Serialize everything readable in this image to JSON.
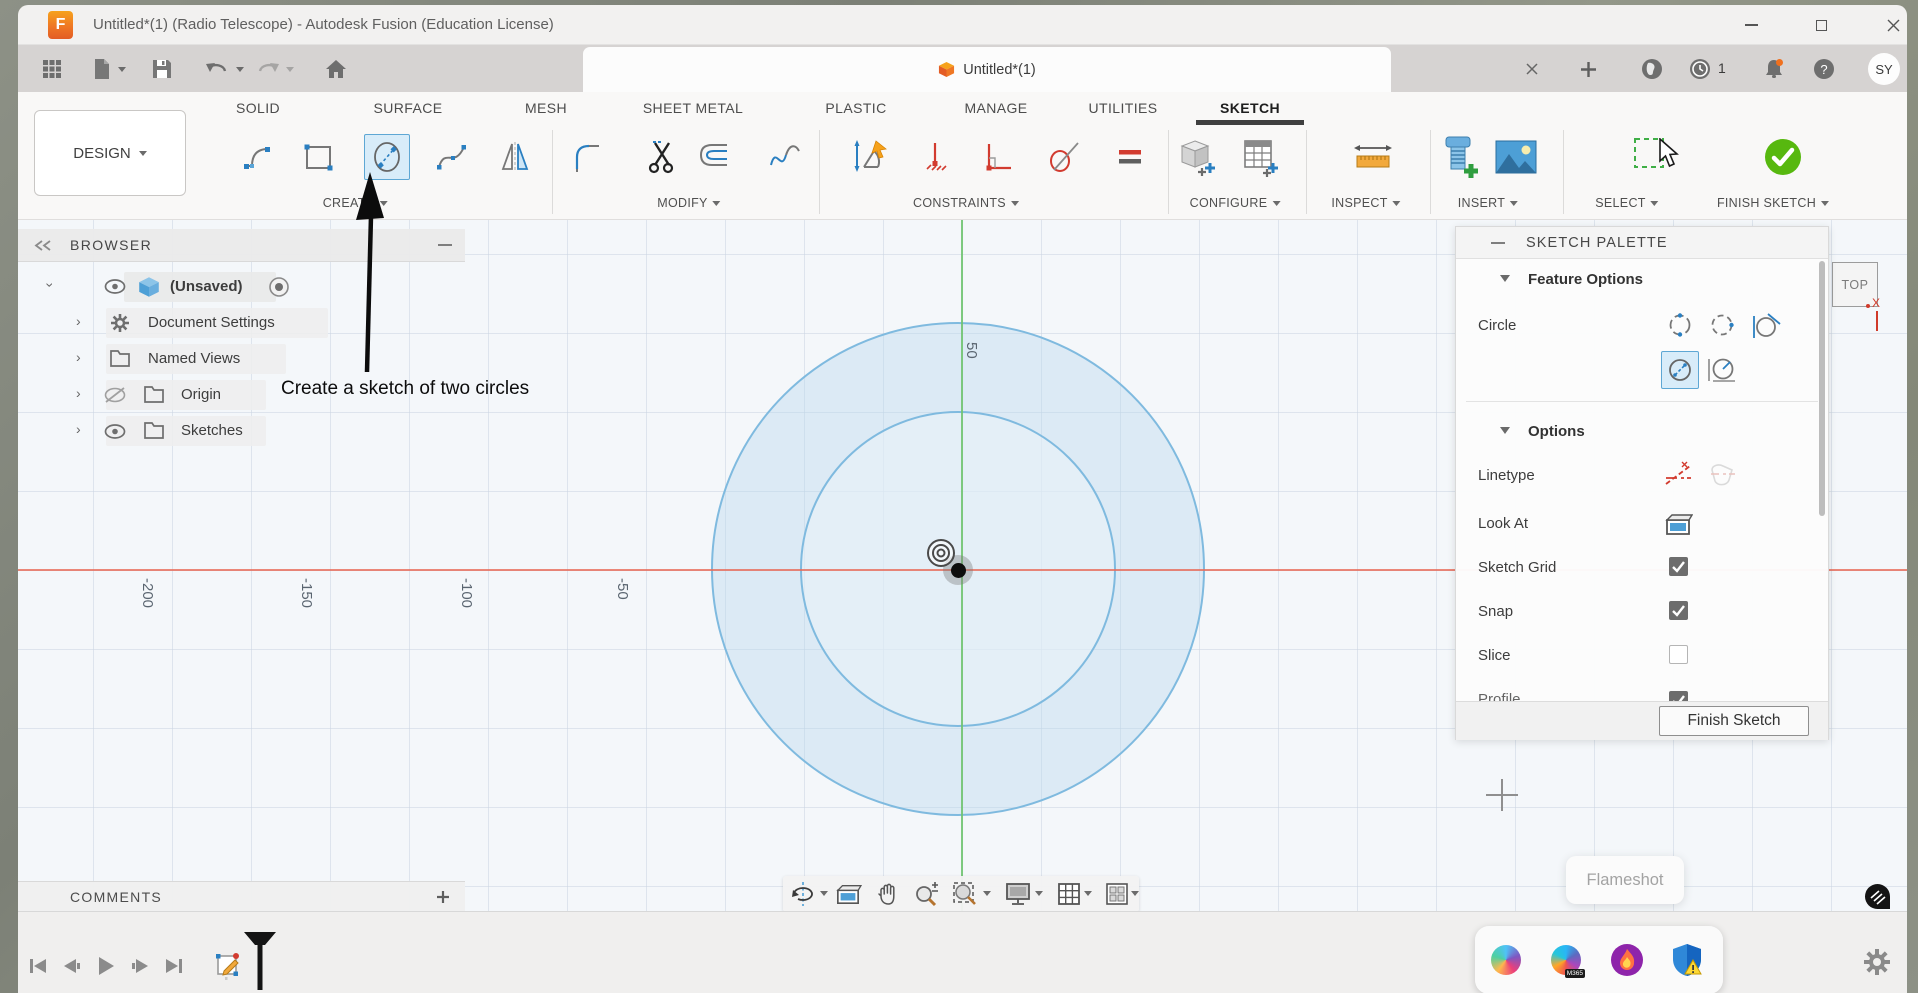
{
  "colors": {
    "axis_red": "#e96a57",
    "axis_green": "#71c471",
    "circle_stroke": "#7fbadf",
    "selection_fill": "#d8ecf9",
    "finish_green": "#57b80f"
  },
  "titlebar": {
    "title": "Untitled*(1) (Radio Telescope) - Autodesk Fusion (Education License)",
    "logo_letter": "F"
  },
  "quickbar": {
    "tab_label": "Untitled*(1)",
    "notification_count": "1",
    "user_initials": "SY",
    "help_glyph": "?"
  },
  "ribbon": {
    "design_label": "DESIGN",
    "active_tab": "SKETCH",
    "tabs": [
      {
        "label": "SOLID"
      },
      {
        "label": "SURFACE"
      },
      {
        "label": "MESH"
      },
      {
        "label": "SHEET METAL"
      },
      {
        "label": "PLASTIC"
      },
      {
        "label": "MANAGE"
      },
      {
        "label": "UTILITIES"
      },
      {
        "label": "SKETCH"
      }
    ],
    "groups": [
      {
        "label": "CREATE"
      },
      {
        "label": "MODIFY"
      },
      {
        "label": "CONSTRAINTS"
      },
      {
        "label": "CONFIGURE"
      },
      {
        "label": "INSPECT"
      },
      {
        "label": "INSERT"
      },
      {
        "label": "SELECT"
      },
      {
        "label": "FINISH SKETCH"
      }
    ]
  },
  "browser": {
    "header": "BROWSER",
    "root_item": "(Unsaved)",
    "items": [
      {
        "label": "Document Settings"
      },
      {
        "label": "Named Views"
      },
      {
        "label": "Origin"
      },
      {
        "label": "Sketches"
      }
    ]
  },
  "annotation": {
    "text": "Create a sketch of two circles"
  },
  "canvas": {
    "x_ticks": [
      {
        "label": "-200"
      },
      {
        "label": "-150"
      },
      {
        "label": "-100"
      },
      {
        "label": "-50"
      }
    ],
    "y_tick": "50"
  },
  "viewcube": {
    "face": "TOP",
    "axis_x": "X"
  },
  "palette": {
    "title": "SKETCH PALETTE",
    "feature_section": "Feature Options",
    "circle_label": "Circle",
    "options_section": "Options",
    "rows": [
      {
        "label": "Linetype"
      },
      {
        "label": "Look At"
      },
      {
        "label": "Sketch Grid",
        "checked": true
      },
      {
        "label": "Snap",
        "checked": true
      },
      {
        "label": "Slice",
        "checked": false
      },
      {
        "label": "Profile",
        "checked": true
      }
    ],
    "finish_button": "Finish Sketch"
  },
  "comments": {
    "header": "COMMENTS"
  },
  "taskbar": {
    "tooltip": "Flameshot",
    "m365_badge": "M365"
  }
}
